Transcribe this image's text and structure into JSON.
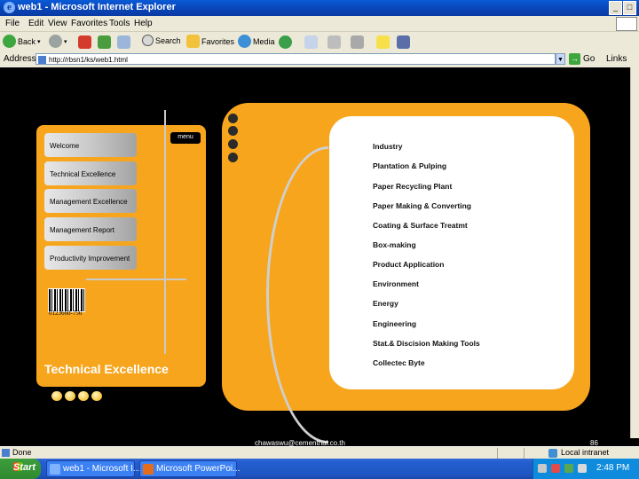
{
  "window": {
    "title": "web1 - Microsoft Internet Explorer"
  },
  "menubar": {
    "items": [
      "File",
      "Edit",
      "View",
      "Favorites",
      "Tools",
      "Help"
    ]
  },
  "toolbar": {
    "back": "Back",
    "search": "Search",
    "favorites": "Favorites",
    "media": "Media"
  },
  "address": {
    "label": "Address",
    "url": "http://rbsn1/ks/web1.html",
    "go": "Go",
    "links": "Links"
  },
  "page": {
    "menu_tab": "menu",
    "left_menu": [
      "Welcome",
      "Technical Excellence",
      "Management Excellence",
      "Management Report",
      "Productivity Improvement"
    ],
    "barcode_number": "0123660-756",
    "section_title": "Technical Excellence",
    "right_menu": [
      "Industry",
      "Plantation & Pulping",
      "Paper Recycling Plant",
      "Paper Making & Converting",
      "Coating & Surface Treatmt",
      "Box-making",
      "Product Application",
      "Environment",
      "Energy",
      "Engineering",
      "Stat.& Discision Making Tools",
      "Collectec Byte"
    ],
    "footer_email": "chawaswu@cementhai.co.th",
    "footer_page": "86"
  },
  "statusbar": {
    "status": "Done",
    "zone": "Local intranet"
  },
  "taskbar": {
    "start": "Start",
    "tasks": [
      "web1 - Microsoft I...",
      "Microsoft PowerPoi..."
    ],
    "clock": "2:48 PM"
  },
  "colors": {
    "orange": "#f7a51d",
    "titlebar": "#0a4fd0",
    "start_green": "#3c9e3c"
  }
}
